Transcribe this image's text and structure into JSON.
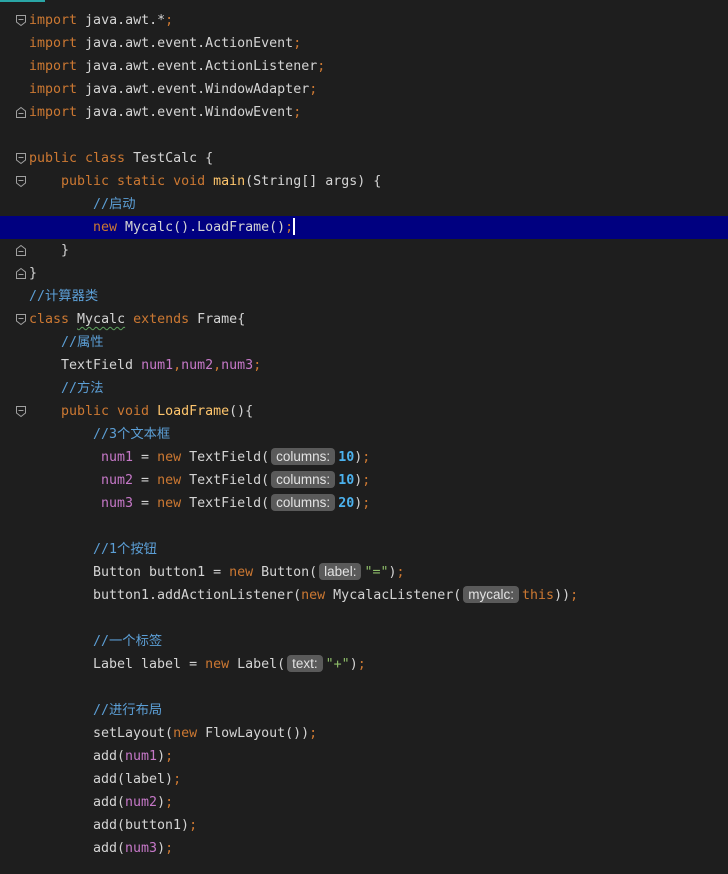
{
  "editor": {
    "colors": {
      "background": "#1e1e1e",
      "text": "#d4d4d4",
      "keyword": "#cc7832",
      "method": "#ffc66d",
      "comment": "#5c9fd6",
      "field": "#c678c8",
      "number": "#4cb2ee",
      "string": "#8fbf6a",
      "hint_bg": "#5a5a5a",
      "hint_text": "#e2e2e2",
      "current_line": "#000080",
      "caret": "#ffffff",
      "typo_underline": "#5fa35f",
      "tab_indicator": "#2aa6a6",
      "fold_icon": "#a0a0a0"
    },
    "lines": [
      {
        "fold": "fold-start-icon",
        "tokens": [
          {
            "t": "import",
            "k": "keyword"
          },
          {
            "t": " java.awt.*",
            "k": "plain"
          },
          {
            "t": ";",
            "k": "punct"
          }
        ]
      },
      {
        "tokens": [
          {
            "t": "import",
            "k": "keyword"
          },
          {
            "t": " java.awt.event.ActionEvent",
            "k": "plain"
          },
          {
            "t": ";",
            "k": "punct"
          }
        ]
      },
      {
        "tokens": [
          {
            "t": "import",
            "k": "keyword"
          },
          {
            "t": " java.awt.event.ActionListener",
            "k": "plain"
          },
          {
            "t": ";",
            "k": "punct"
          }
        ]
      },
      {
        "tokens": [
          {
            "t": "import",
            "k": "keyword"
          },
          {
            "t": " java.awt.event.WindowAdapter",
            "k": "plain"
          },
          {
            "t": ";",
            "k": "punct"
          }
        ]
      },
      {
        "fold": "fold-end-icon",
        "tokens": [
          {
            "t": "import",
            "k": "keyword"
          },
          {
            "t": " java.awt.event.WindowEvent",
            "k": "plain"
          },
          {
            "t": ";",
            "k": "punct"
          }
        ]
      },
      {
        "tokens": []
      },
      {
        "fold": "fold-start-icon",
        "tokens": [
          {
            "t": "public class",
            "k": "keyword"
          },
          {
            "t": " TestCalc {",
            "k": "plain"
          }
        ]
      },
      {
        "fold": "fold-start-icon",
        "tokens": [
          {
            "t": "public static void",
            "k": "keyword"
          },
          {
            "t": " ",
            "k": "plain"
          },
          {
            "t": "main",
            "k": "method"
          },
          {
            "t": "(String[] args) {",
            "k": "plain"
          }
        ]
      },
      {
        "tokens": [
          {
            "t": "//启动",
            "k": "comment"
          }
        ]
      },
      {
        "current": true,
        "caret": true,
        "tokens": [
          {
            "t": "new",
            "k": "keyword"
          },
          {
            "t": " Mycalc().LoadFrame()",
            "k": "plain"
          },
          {
            "t": ";",
            "k": "punct"
          }
        ]
      },
      {
        "fold": "fold-end-icon",
        "tokens": [
          {
            "t": "}",
            "k": "plain"
          }
        ]
      },
      {
        "fold": "fold-end-icon",
        "tokens": [
          {
            "t": "}",
            "k": "plain"
          }
        ]
      },
      {
        "tokens": [
          {
            "t": "//计算器类",
            "k": "comment"
          }
        ]
      },
      {
        "fold": "fold-start-icon",
        "tokens": [
          {
            "t": "class",
            "k": "keyword"
          },
          {
            "t": " ",
            "k": "plain"
          },
          {
            "t": "Mycalc",
            "k": "plain",
            "typo": true
          },
          {
            "t": " ",
            "k": "plain"
          },
          {
            "t": "extends",
            "k": "keyword"
          },
          {
            "t": " Frame{",
            "k": "plain"
          }
        ]
      },
      {
        "tokens": [
          {
            "t": "//属性",
            "k": "comment"
          }
        ]
      },
      {
        "tokens": [
          {
            "t": "TextField ",
            "k": "plain"
          },
          {
            "t": "num1",
            "k": "field"
          },
          {
            "t": ",",
            "k": "punct"
          },
          {
            "t": "num2",
            "k": "field"
          },
          {
            "t": ",",
            "k": "punct"
          },
          {
            "t": "num3",
            "k": "field"
          },
          {
            "t": ";",
            "k": "punct"
          }
        ]
      },
      {
        "tokens": [
          {
            "t": "//方法",
            "k": "comment"
          }
        ]
      },
      {
        "fold": "fold-start-icon",
        "tokens": [
          {
            "t": "public void",
            "k": "keyword"
          },
          {
            "t": " ",
            "k": "plain"
          },
          {
            "t": "LoadFrame",
            "k": "method"
          },
          {
            "t": "(){",
            "k": "plain"
          }
        ]
      },
      {
        "tokens": [
          {
            "t": "//3个文本框",
            "k": "comment"
          }
        ]
      },
      {
        "tokens": [
          {
            "t": "num1",
            "k": "field"
          },
          {
            "t": " = ",
            "k": "plain"
          },
          {
            "t": "new",
            "k": "keyword"
          },
          {
            "t": " TextField(",
            "k": "plain"
          },
          {
            "t": "columns:",
            "k": "hint"
          },
          {
            "t": "10",
            "k": "number"
          },
          {
            "t": ")",
            "k": "plain"
          },
          {
            "t": ";",
            "k": "punct"
          }
        ]
      },
      {
        "tokens": [
          {
            "t": "num2",
            "k": "field"
          },
          {
            "t": " = ",
            "k": "plain"
          },
          {
            "t": "new",
            "k": "keyword"
          },
          {
            "t": " TextField(",
            "k": "plain"
          },
          {
            "t": "columns:",
            "k": "hint"
          },
          {
            "t": "10",
            "k": "number"
          },
          {
            "t": ")",
            "k": "plain"
          },
          {
            "t": ";",
            "k": "punct"
          }
        ]
      },
      {
        "tokens": [
          {
            "t": "num3",
            "k": "field"
          },
          {
            "t": " = ",
            "k": "plain"
          },
          {
            "t": "new",
            "k": "keyword"
          },
          {
            "t": " TextField(",
            "k": "plain"
          },
          {
            "t": "columns:",
            "k": "hint"
          },
          {
            "t": "20",
            "k": "number"
          },
          {
            "t": ")",
            "k": "plain"
          },
          {
            "t": ";",
            "k": "punct"
          }
        ]
      },
      {
        "tokens": []
      },
      {
        "tokens": [
          {
            "t": "//1个按钮",
            "k": "comment"
          }
        ]
      },
      {
        "tokens": [
          {
            "t": "Button button1 = ",
            "k": "plain"
          },
          {
            "t": "new",
            "k": "keyword"
          },
          {
            "t": " Button(",
            "k": "plain"
          },
          {
            "t": "label:",
            "k": "hint"
          },
          {
            "t": "\"=\"",
            "k": "string"
          },
          {
            "t": ")",
            "k": "plain"
          },
          {
            "t": ";",
            "k": "punct"
          }
        ]
      },
      {
        "tokens": [
          {
            "t": "button1.addActionListener(",
            "k": "plain"
          },
          {
            "t": "new",
            "k": "keyword"
          },
          {
            "t": " MycalacListener(",
            "k": "plain"
          },
          {
            "t": "mycalc:",
            "k": "hint"
          },
          {
            "t": "this",
            "k": "keyword"
          },
          {
            "t": "))",
            "k": "plain"
          },
          {
            "t": ";",
            "k": "punct"
          }
        ]
      },
      {
        "tokens": []
      },
      {
        "tokens": [
          {
            "t": "//一个标签",
            "k": "comment"
          }
        ]
      },
      {
        "tokens": [
          {
            "t": "Label label = ",
            "k": "plain"
          },
          {
            "t": "new",
            "k": "keyword"
          },
          {
            "t": " Label(",
            "k": "plain"
          },
          {
            "t": "text:",
            "k": "hint"
          },
          {
            "t": "\"+\"",
            "k": "string"
          },
          {
            "t": ")",
            "k": "plain"
          },
          {
            "t": ";",
            "k": "punct"
          }
        ]
      },
      {
        "tokens": []
      },
      {
        "tokens": [
          {
            "t": "//进行布局",
            "k": "comment"
          }
        ]
      },
      {
        "tokens": [
          {
            "t": "setLayout(",
            "k": "plain"
          },
          {
            "t": "new",
            "k": "keyword"
          },
          {
            "t": " FlowLayout())",
            "k": "plain"
          },
          {
            "t": ";",
            "k": "punct"
          }
        ]
      },
      {
        "tokens": [
          {
            "t": "add(",
            "k": "plain"
          },
          {
            "t": "num1",
            "k": "field"
          },
          {
            "t": ")",
            "k": "plain"
          },
          {
            "t": ";",
            "k": "punct"
          }
        ]
      },
      {
        "tokens": [
          {
            "t": "add(label)",
            "k": "plain"
          },
          {
            "t": ";",
            "k": "punct"
          }
        ]
      },
      {
        "tokens": [
          {
            "t": "add(",
            "k": "plain"
          },
          {
            "t": "num2",
            "k": "field"
          },
          {
            "t": ")",
            "k": "plain"
          },
          {
            "t": ";",
            "k": "punct"
          }
        ]
      },
      {
        "tokens": [
          {
            "t": "add(button1)",
            "k": "plain"
          },
          {
            "t": ";",
            "k": "punct"
          }
        ]
      },
      {
        "tokens": [
          {
            "t": "add(",
            "k": "plain"
          },
          {
            "t": "num3",
            "k": "field"
          },
          {
            "t": ")",
            "k": "plain"
          },
          {
            "t": ";",
            "k": "punct"
          }
        ]
      }
    ]
  }
}
